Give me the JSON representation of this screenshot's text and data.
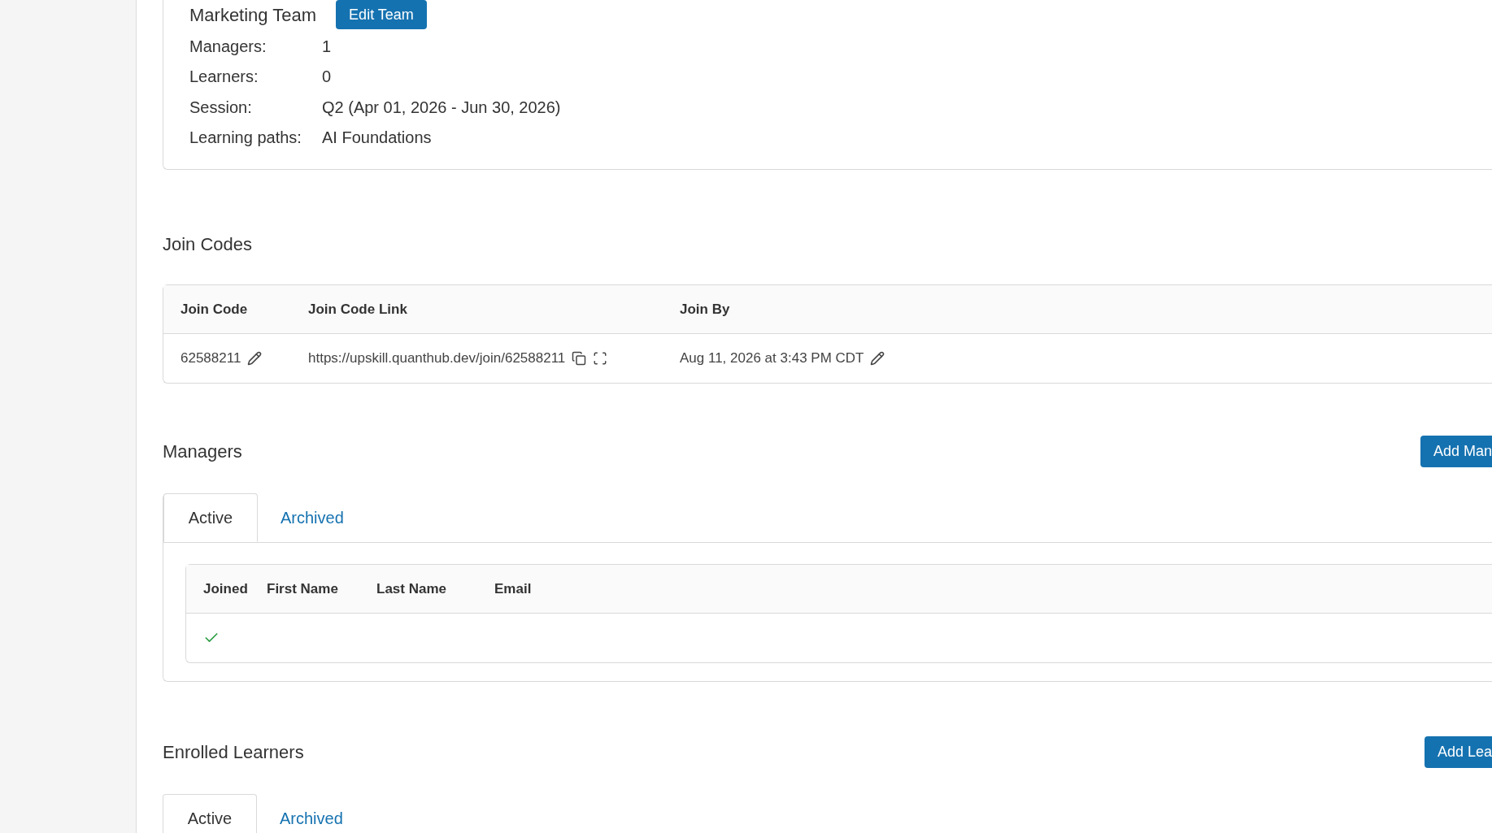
{
  "team": {
    "name": "Marketing Team",
    "edit_button": "Edit Team",
    "details": [
      {
        "label": "Managers:",
        "value": "1"
      },
      {
        "label": "Learners:",
        "value": "0"
      },
      {
        "label": "Session:",
        "value": "Q2 (Apr 01, 2026 - Jun 30, 2026)"
      },
      {
        "label": "Learning paths:",
        "value": "AI Foundations"
      }
    ]
  },
  "join_codes": {
    "title": "Join Codes",
    "columns": [
      "Join Code",
      "Join Code Link",
      "Join By"
    ],
    "rows": [
      {
        "code": "62588211",
        "link": "https://upskill.quanthub.dev/join/62588211",
        "join_by": "Aug 11, 2026 at 3:43 PM CDT"
      }
    ]
  },
  "managers": {
    "title": "Managers",
    "add_button": "Add Man",
    "tabs": [
      {
        "label": "Active",
        "selected": true
      },
      {
        "label": "Archived",
        "selected": false
      }
    ],
    "columns": [
      "Joined",
      "First Name",
      "Last Name",
      "Email"
    ],
    "rows": [
      {
        "joined": true
      }
    ]
  },
  "enrolled_learners": {
    "title": "Enrolled Learners",
    "add_button": "Add Lea",
    "tabs": [
      {
        "label": "Active",
        "selected": true
      },
      {
        "label": "Archived",
        "selected": false
      }
    ]
  }
}
